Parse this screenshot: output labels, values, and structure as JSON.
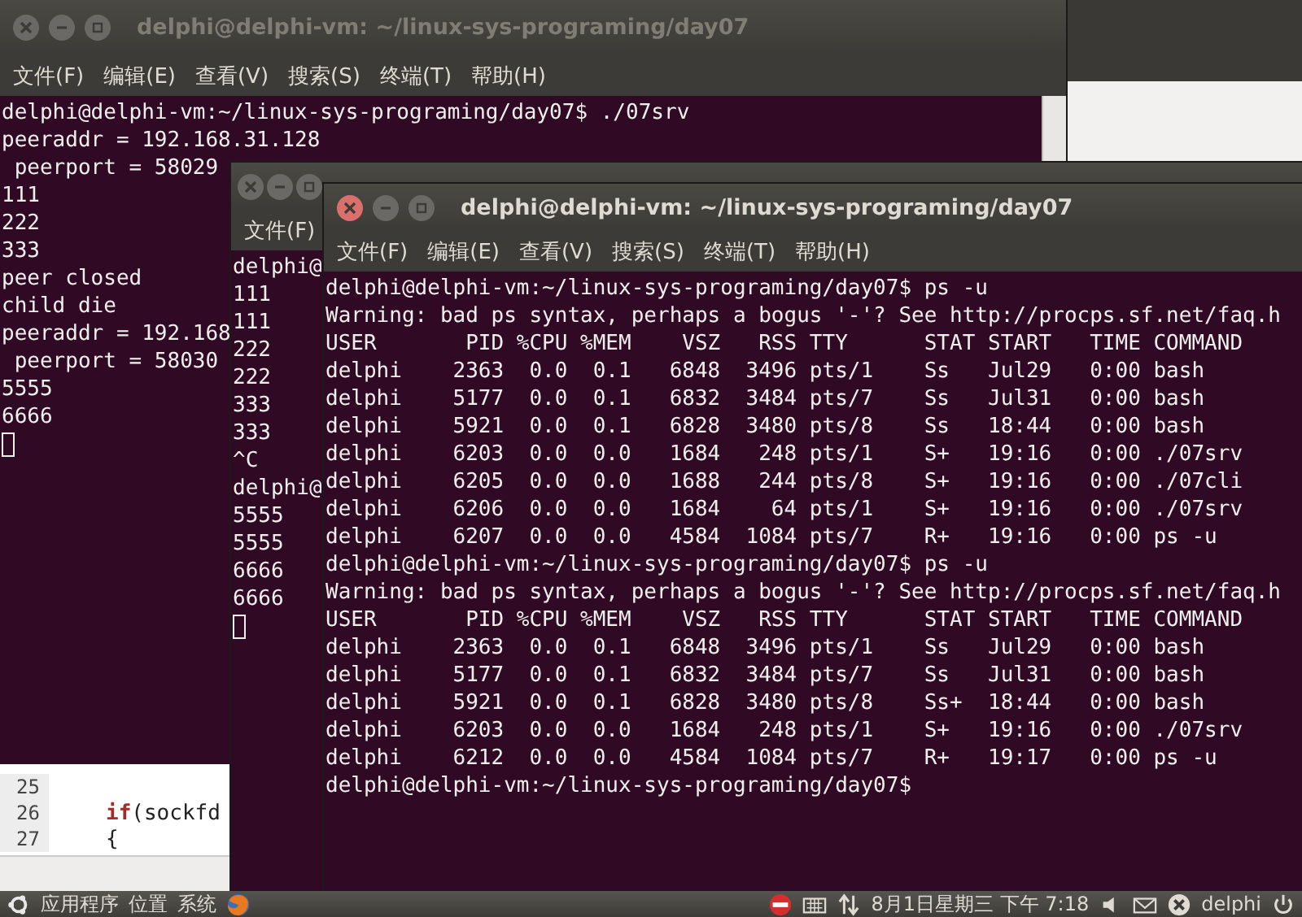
{
  "windows": [
    {
      "title": "delphi@delphi-vm: ~/linux-sys-programing/day07",
      "active": false,
      "menu": [
        "文件(F)",
        "编辑(E)",
        "查看(V)",
        "搜索(S)",
        "终端(T)",
        "帮助(H)"
      ],
      "lines": [
        "delphi@delphi-vm:~/linux-sys-programing/day07$ ./07srv",
        "peeraddr = 192.168.31.128",
        " peerport = 58029",
        "111",
        "222",
        "333",
        "peer closed",
        "child die",
        "peeraddr = 192.168",
        " peerport = 58030",
        "5555",
        "6666"
      ],
      "cursor": true,
      "scrollbar": true
    },
    {
      "active": false,
      "menu": [
        "文件(F)"
      ],
      "lines": [
        "delphi@",
        "111",
        "111",
        "222",
        "222",
        "333",
        "333",
        "^C",
        "delphi@",
        "5555",
        "5555",
        "6666",
        "6666"
      ],
      "cursor": true,
      "scrollbar": false
    },
    {
      "title": "delphi@delphi-vm: ~/linux-sys-programing/day07",
      "active": true,
      "menu": [
        "文件(F)",
        "编辑(E)",
        "查看(V)",
        "搜索(S)",
        "终端(T)",
        "帮助(H)"
      ],
      "lines": [
        "delphi@delphi-vm:~/linux-sys-programing/day07$ ps -u",
        "Warning: bad ps syntax, perhaps a bogus '-'? See http://procps.sf.net/faq.h",
        "USER       PID %CPU %MEM    VSZ   RSS TTY      STAT START   TIME COMMAND",
        "delphi    2363  0.0  0.1   6848  3496 pts/1    Ss   Jul29   0:00 bash",
        "delphi    5177  0.0  0.1   6832  3484 pts/7    Ss   Jul31   0:00 bash",
        "delphi    5921  0.0  0.1   6828  3480 pts/8    Ss   18:44   0:00 bash",
        "delphi    6203  0.0  0.0   1684   248 pts/1    S+   19:16   0:00 ./07srv",
        "delphi    6205  0.0  0.0   1688   244 pts/8    S+   19:16   0:00 ./07cli",
        "delphi    6206  0.0  0.0   1684    64 pts/1    S+   19:16   0:00 ./07srv",
        "delphi    6207  0.0  0.0   4584  1084 pts/7    R+   19:16   0:00 ps -u",
        "delphi@delphi-vm:~/linux-sys-programing/day07$ ps -u",
        "Warning: bad ps syntax, perhaps a bogus '-'? See http://procps.sf.net/faq.h",
        "USER       PID %CPU %MEM    VSZ   RSS TTY      STAT START   TIME COMMAND",
        "delphi    2363  0.0  0.1   6848  3496 pts/1    Ss   Jul29   0:00 bash",
        "delphi    5177  0.0  0.1   6832  3484 pts/7    Ss   Jul31   0:00 bash",
        "delphi    5921  0.0  0.1   6828  3480 pts/8    Ss+  18:44   0:00 bash",
        "delphi    6203  0.0  0.0   1684   248 pts/1    S+   19:16   0:00 ./07srv",
        "delphi    6212  0.0  0.0   4584  1084 pts/7    R+   19:17   0:00 ps -u",
        "delphi@delphi-vm:~/linux-sys-programing/day07$"
      ],
      "cursor": false,
      "scrollbar": false
    }
  ],
  "editor": {
    "lines": [
      {
        "number": "25"
      },
      {
        "number": "26",
        "tokens": [
          {
            "kind": "keyword",
            "text": "if"
          },
          {
            "kind": "plain",
            "text": "(sockfd"
          }
        ]
      },
      {
        "number": "27",
        "tokens": [
          {
            "kind": "plain",
            "text": "{"
          }
        ]
      }
    ]
  },
  "taskbar": {
    "menus": [
      "应用程序",
      "位置",
      "系统"
    ],
    "clock": "8月1日星期三 下午 7:18",
    "user": "delphi"
  }
}
